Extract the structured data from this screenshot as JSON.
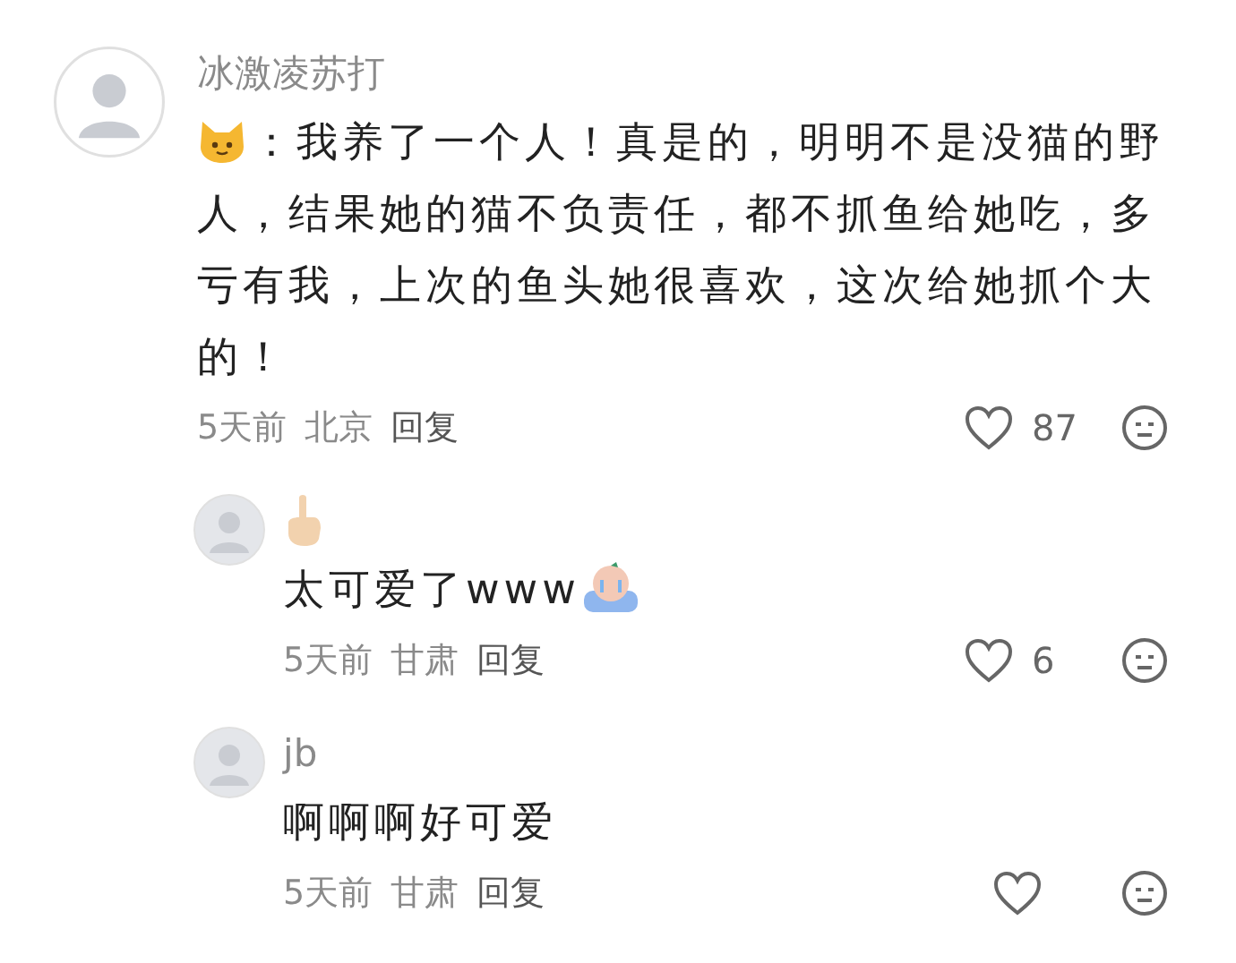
{
  "comments": [
    {
      "kind": "main",
      "author": "冰激凌苏打",
      "text": "：我养了一个人！真是的，明明不是没猫的野人，结果她的猫不负责任，都不抓鱼给她吃，多亏有我，上次的鱼头她很喜欢，这次给她抓个大的！",
      "time": "5天前",
      "location": "北京",
      "reply": "回复",
      "likes": "87"
    },
    {
      "kind": "sticker",
      "text": "太可爱了www",
      "time": "5天前",
      "location": "甘肃",
      "reply": "回复",
      "likes": "6"
    },
    {
      "kind": "reply",
      "author": "jb",
      "text": "啊啊啊好可爱",
      "time": "5天前",
      "location": "甘肃",
      "reply": "回复"
    }
  ]
}
